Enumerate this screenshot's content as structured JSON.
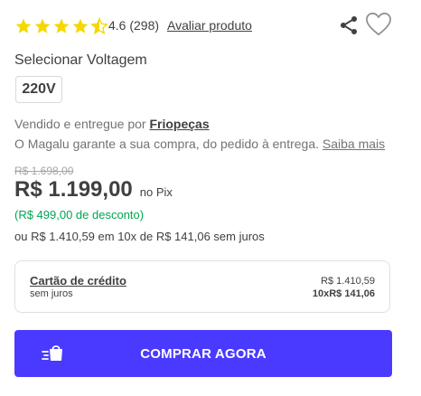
{
  "rating": {
    "stars_value": 4.6,
    "stars_max": 5,
    "text": "4.6 (298)",
    "review_link": "Avaliar produto",
    "star_color": "#f5d800"
  },
  "actions": {
    "share_icon": "share-icon",
    "favorite_icon": "heart-icon"
  },
  "voltage": {
    "label": "Selecionar Voltagem",
    "selected": "220V"
  },
  "seller": {
    "prefix": "Vendido e entregue por ",
    "name": "Friopeças",
    "guarantee": "O Magalu garante a sua compra, do pedido à entrega.",
    "more_link": "Saiba mais"
  },
  "price": {
    "old": "R$ 1.698,00",
    "current": "R$ 1.199,00",
    "method": "no Pix",
    "discount": "(R$ 499,00 de desconto)",
    "installments": "ou R$ 1.410,59 em 10x de R$ 141,06 sem juros",
    "discount_color": "#00a650"
  },
  "card": {
    "title": "Cartão de crédito",
    "subtitle": "sem juros",
    "total": "R$ 1.410,59",
    "installment": "10xR$ 141,06"
  },
  "buy": {
    "label": "COMPRAR AGORA",
    "icon": "shopping-bag-fast-icon",
    "color": "#4a3aff"
  }
}
